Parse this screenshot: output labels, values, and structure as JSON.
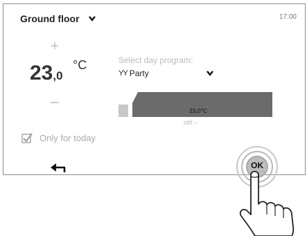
{
  "header": {
    "zone": "Ground floor",
    "zone_icon": "chevron-down-icon",
    "time": "17:00"
  },
  "temperature": {
    "increase_label": "+",
    "integer": "23",
    "decimal": ",0",
    "unit": "°C",
    "decrease_label": "–"
  },
  "program": {
    "label": "Select day program:",
    "icon": "cocktail-glasses-icon",
    "icon_glyph": "ΥΥ",
    "selected": "Party",
    "profile_value": "23,0°C",
    "profile_note": "still –"
  },
  "options": {
    "only_for_today_label": "Only for today",
    "only_for_today_checked": true
  },
  "footer": {
    "back_icon": "back-arrow-icon",
    "ok_label": "OK"
  },
  "colors": {
    "profile_fill": "#6b6b6b",
    "profile_start": "#c8c8c8",
    "ring": "#b0b0b0"
  }
}
